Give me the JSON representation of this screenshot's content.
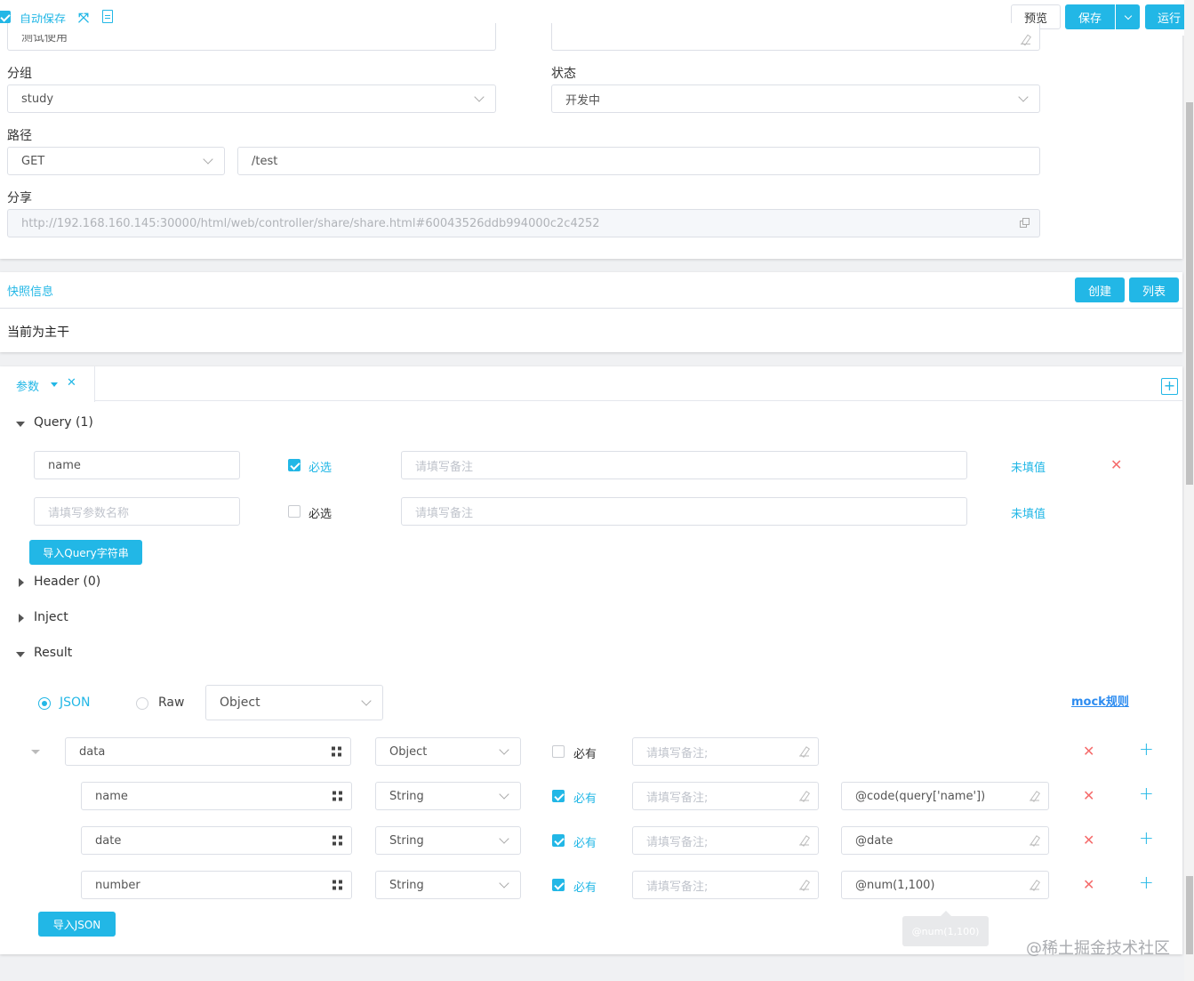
{
  "toolbar": {
    "autosave_label": "自动保存",
    "preview_label": "预览",
    "save_label": "保存",
    "run_label": "运行"
  },
  "form": {
    "name_value_partial": "测试使用",
    "group_label": "分组",
    "group_value": "study",
    "status_label": "状态",
    "status_value": "开发中",
    "path_label": "路径",
    "method_value": "GET",
    "path_value": "/test",
    "share_label": "分享",
    "share_url": "http://192.168.160.145:30000/html/web/controller/share/share.html#60043526ddb994000c2c4252"
  },
  "snapshot": {
    "title": "快照信息",
    "create_label": "创建",
    "list_label": "列表",
    "current_text": "当前为主干"
  },
  "params": {
    "tab_label": "参数",
    "query_title": "Query (1)",
    "query_rows": [
      {
        "name": "name",
        "required_label": "必选",
        "required": true,
        "remark_placeholder": "请填写备注",
        "value_link": "未填值"
      },
      {
        "name_placeholder": "请填写参数名称",
        "required_label": "必选",
        "required": false,
        "remark_placeholder": "请填写备注",
        "value_link": "未填值"
      }
    ],
    "import_query_label": "导入Query字符串",
    "header_title": "Header (0)",
    "inject_title": "Inject",
    "result_title": "Result",
    "json_label": "JSON",
    "raw_label": "Raw",
    "result_type": "Object",
    "mock_rules_label": "mock规则",
    "result_rows": [
      {
        "name": "data",
        "type": "Object",
        "required_label": "必有",
        "required": false,
        "remark_placeholder": "请填写备注;",
        "mock": ""
      },
      {
        "name": "name",
        "type": "String",
        "required_label": "必有",
        "required": true,
        "remark_placeholder": "请填写备注;",
        "mock": "@code(query['name'])"
      },
      {
        "name": "date",
        "type": "String",
        "required_label": "必有",
        "required": true,
        "remark_placeholder": "请填写备注;",
        "mock": "@date"
      },
      {
        "name": "number",
        "type": "String",
        "required_label": "必有",
        "required": true,
        "remark_placeholder": "请填写备注;",
        "mock": "@num(1,100)"
      }
    ],
    "import_json_label": "导入JSON",
    "tooltip_text": "@num(1,100)"
  },
  "watermark": "@稀土掘金技术社区",
  "colors": {
    "accent": "#22b7e6",
    "danger": "#f56c6c"
  }
}
